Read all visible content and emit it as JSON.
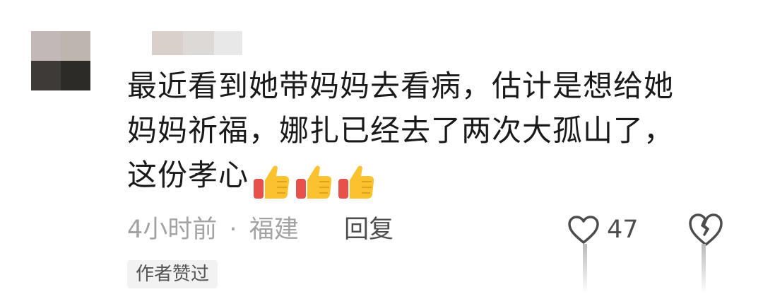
{
  "comment": {
    "line1": "最近看到她带妈妈去看病，估计是想给她",
    "line2": "妈妈祈福，娜扎已经去了两次大孤山了，",
    "line3": "这份孝心",
    "emoji": [
      "thumbs-up",
      "thumbs-up",
      "thumbs-up"
    ]
  },
  "meta": {
    "time": "4小时前",
    "separator": "·",
    "location": "福建",
    "reply_label": "回复"
  },
  "likes": {
    "count": "47"
  },
  "badge": {
    "label": "作者赞过"
  },
  "colors": {
    "text": "#1a1a1a",
    "meta": "#a3a3a3",
    "action": "#4d4d4d",
    "badge_bg": "#f2f2f2",
    "thumb_yellow": "#f9c22e",
    "thumb_red": "#e8514b"
  },
  "icons": {
    "avatar": "blurred-avatar",
    "like": "heart-outline-icon",
    "dislike": "broken-heart-icon"
  }
}
